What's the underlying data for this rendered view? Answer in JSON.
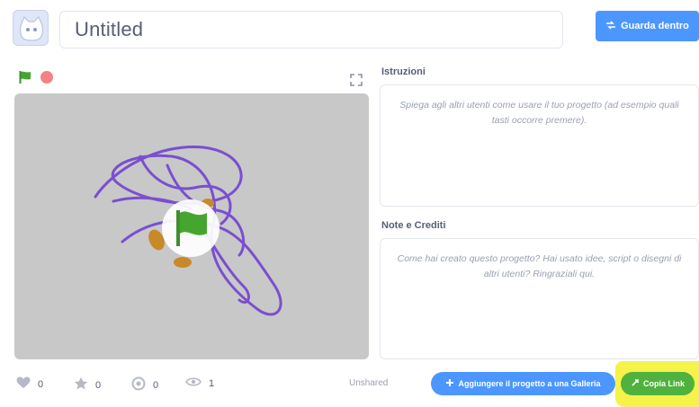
{
  "header": {
    "project_title": "Untitled",
    "see_inside_label": "Guarda dentro",
    "avatar_icon": "scratch-cat-avatar-icon",
    "see_inside_icon": "remix-icon"
  },
  "stage_controls": {
    "green_flag_icon": "green-flag-icon",
    "stop_icon": "stop-sign-icon",
    "fullscreen_icon": "fullscreen-icon"
  },
  "instructions": {
    "title": "Istruzioni",
    "placeholder": "Spiega agli altri utenti come usare il tuo progetto (ad esempio quali tasti occorre premere)."
  },
  "notes": {
    "title": "Note e Crediti",
    "placeholder": "Come hai creato questo progetto? Hai usato idee, script o disegni di altri utenti? Ringraziali qui."
  },
  "stats": [
    {
      "icon": "heart-icon",
      "value": "0"
    },
    {
      "icon": "star-icon",
      "value": "0"
    },
    {
      "icon": "remix-icon",
      "value": "0"
    },
    {
      "icon": "eye-icon",
      "value": "1"
    }
  ],
  "footer": {
    "unshared_label": "Unshared",
    "add_to_studio_label": "Aggiungere il progetto a una Galleria",
    "copy_link_label": "Copia Link"
  },
  "colors": {
    "accent_blue": "#4c97ff",
    "copy_link_green": "#4fb23f",
    "highlight_yellow": "#f5f24a",
    "stage_gray": "#c8c8c8",
    "sprite_purple": "#7a4fd0"
  }
}
